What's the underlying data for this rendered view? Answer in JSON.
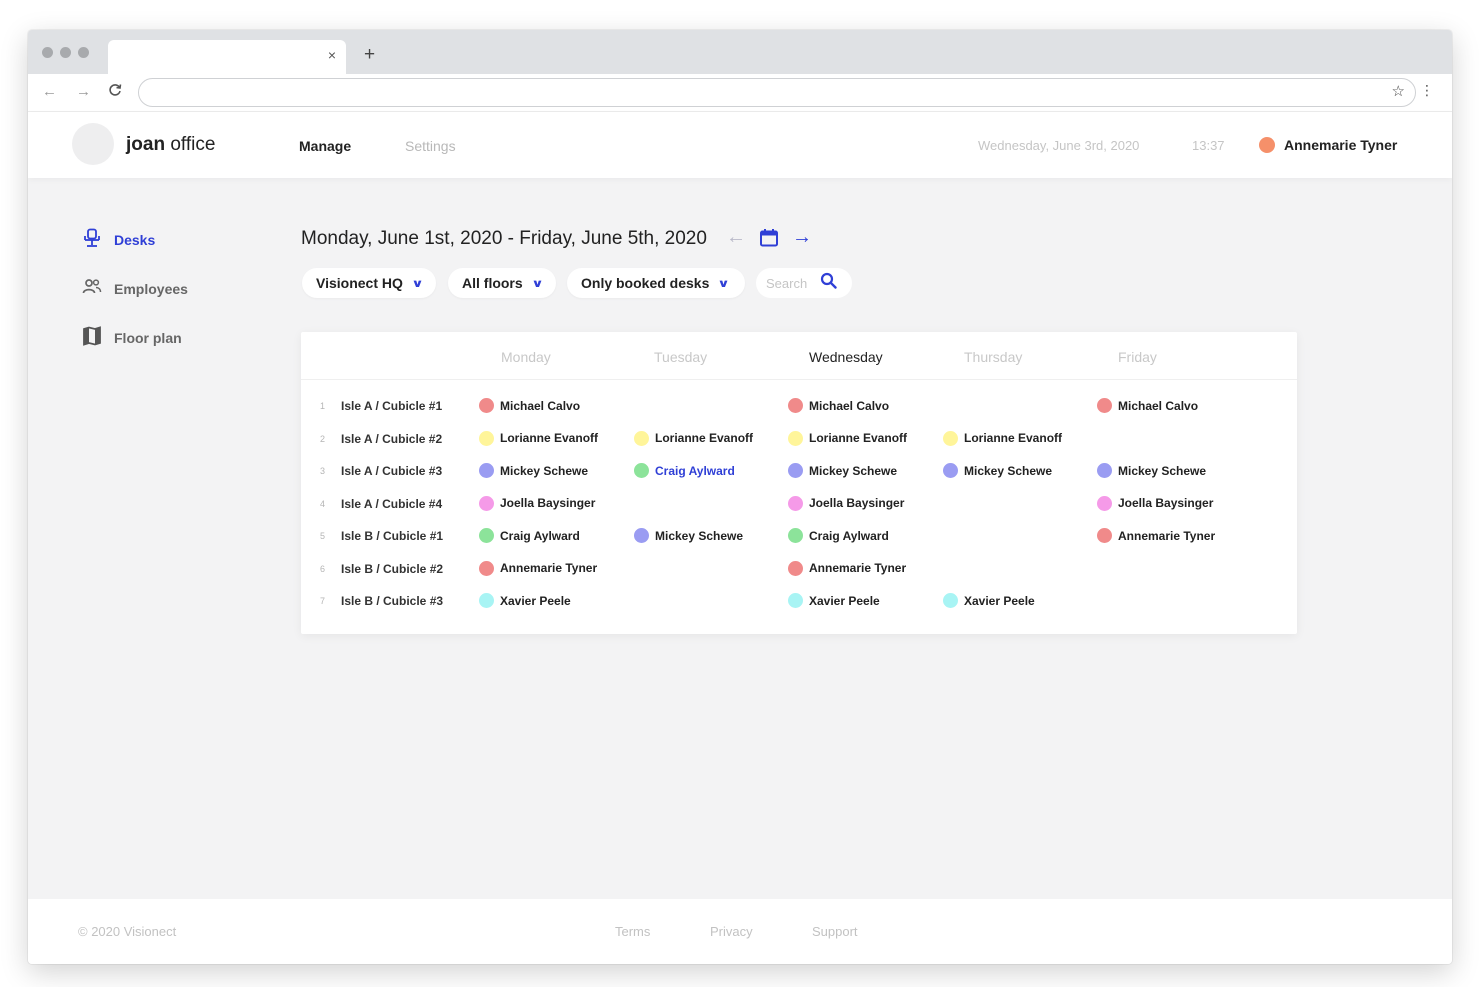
{
  "browser": {
    "tab_close": "×",
    "new_tab": "+",
    "back": "←",
    "forward": "→",
    "reload": "C",
    "bookmark": "☆",
    "menu": "⋮"
  },
  "header": {
    "brand_bold": "joan",
    "brand_light": "office",
    "nav": {
      "manage": "Manage",
      "settings": "Settings"
    },
    "date": "Wednesday, June 3rd, 2020",
    "time": "13:37",
    "user": "Annemarie Tyner",
    "user_color": "#f5906a"
  },
  "sidebar": {
    "items": [
      {
        "label": "Desks",
        "icon": "desk-chair-icon",
        "active": true
      },
      {
        "label": "Employees",
        "icon": "people-icon",
        "active": false
      },
      {
        "label": "Floor plan",
        "icon": "map-icon",
        "active": false
      }
    ]
  },
  "main": {
    "range": "Monday, June 1st, 2020 - Friday, June 5th, 2020",
    "prev": "←",
    "next": "→",
    "filters": {
      "location": "Visionect HQ",
      "floors": "All floors",
      "booked": "Only booked desks"
    },
    "search_placeholder": "Search"
  },
  "accent_color": "#2f3fd6",
  "people_colors": {
    "Michael Calvo": "#f08a8a",
    "Lorianne Evanoff": "#fff59a",
    "Mickey Schewe": "#9a9cf2",
    "Joella Baysinger": "#f59ae8",
    "Craig Aylward": "#8ce39a",
    "Annemarie Tyner": "#f08a8a",
    "Xavier Peele": "#a8f4f4"
  },
  "table": {
    "days": [
      "Monday",
      "Tuesday",
      "Wednesday",
      "Thursday",
      "Friday"
    ],
    "current_day": "Wednesday",
    "rows": [
      {
        "num": "1",
        "desk": "Isle A / Cubicle #1",
        "cells": [
          "Michael Calvo",
          "",
          "Michael Calvo",
          "",
          "Michael Calvo"
        ]
      },
      {
        "num": "2",
        "desk": "Isle A / Cubicle #2",
        "cells": [
          "Lorianne Evanoff",
          "Lorianne Evanoff",
          "Lorianne Evanoff",
          "Lorianne Evanoff",
          ""
        ]
      },
      {
        "num": "3",
        "desk": "Isle A / Cubicle #3",
        "cells": [
          "Mickey Schewe",
          "Craig Aylward",
          "Mickey Schewe",
          "Mickey Schewe",
          "Mickey Schewe"
        ],
        "highlight": [
          1
        ]
      },
      {
        "num": "4",
        "desk": "Isle A / Cubicle #4",
        "cells": [
          "Joella Baysinger",
          "",
          "Joella Baysinger",
          "",
          "Joella Baysinger"
        ]
      },
      {
        "num": "5",
        "desk": "Isle B / Cubicle #1",
        "cells": [
          "Craig Aylward",
          "Mickey Schewe",
          "Craig Aylward",
          "",
          "Annemarie Tyner"
        ]
      },
      {
        "num": "6",
        "desk": "Isle B / Cubicle #2",
        "cells": [
          "Annemarie Tyner",
          "",
          "Annemarie Tyner",
          "",
          ""
        ]
      },
      {
        "num": "7",
        "desk": "Isle B / Cubicle #3",
        "cells": [
          "Xavier Peele",
          "",
          "Xavier Peele",
          "Xavier Peele",
          ""
        ]
      }
    ]
  },
  "footer": {
    "copyright": "© 2020 Visionect",
    "links": {
      "terms": "Terms",
      "privacy": "Privacy",
      "support": "Support"
    }
  }
}
